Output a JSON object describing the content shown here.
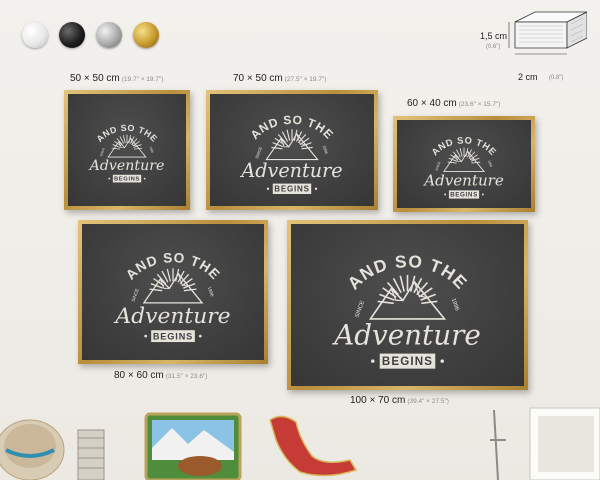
{
  "finishes": [
    {
      "name": "white",
      "icon": "white-finish-swatch"
    },
    {
      "name": "black",
      "icon": "black-finish-swatch"
    },
    {
      "name": "silver",
      "icon": "silver-finish-swatch"
    },
    {
      "name": "gold",
      "icon": "gold-finish-swatch"
    }
  ],
  "profile": {
    "depth_label": "1,5 cm",
    "depth_sub": "(0.6\")",
    "width_label": "2 cm",
    "width_sub": "(0.8\")"
  },
  "sizes": [
    {
      "label": "50 × 50 cm",
      "sub": "(19.7\" × 19.7\")"
    },
    {
      "label": "70 × 50 cm",
      "sub": "(27.5\" × 19.7\")"
    },
    {
      "label": "60 × 40 cm",
      "sub": "(23.6\" × 15.7\")"
    },
    {
      "label": "80 × 60 cm",
      "sub": "(31.5\" × 23.6\")"
    },
    {
      "label": "100 × 70 cm",
      "sub": "(39.4\" × 27.5\")"
    }
  ],
  "artwork": {
    "line1": "AND SO THE",
    "line2": "Adventure",
    "line3": "BEGINS",
    "since": "SINCE",
    "year": "1996"
  },
  "colors": {
    "frame": "#c39a45",
    "art_bg": "#404040",
    "art_ink": "#e6e3dc",
    "page_bg": "#f0eee9"
  }
}
